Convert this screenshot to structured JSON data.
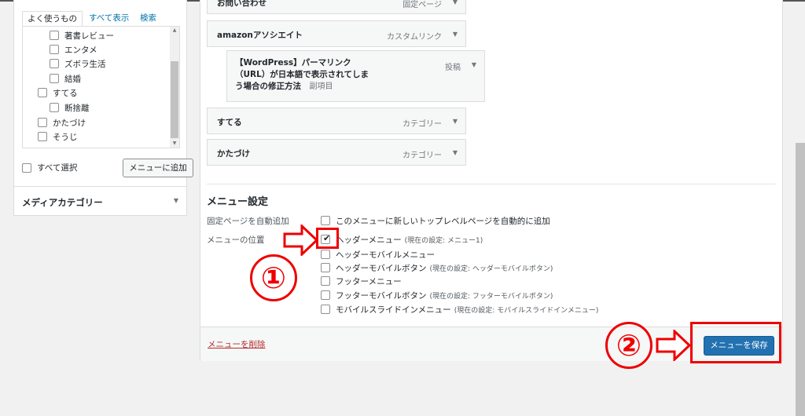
{
  "left_panel": {
    "tabs": [
      "よく使うもの",
      "すべて表示",
      "検索"
    ],
    "items": [
      {
        "label": "著書レビュー",
        "indent": 1
      },
      {
        "label": "エンタメ",
        "indent": 1
      },
      {
        "label": "ズボラ生活",
        "indent": 1
      },
      {
        "label": "結婚",
        "indent": 1
      },
      {
        "label": "すてる",
        "indent": 0
      },
      {
        "label": "断捨離",
        "indent": 1
      },
      {
        "label": "かたづけ",
        "indent": 0
      },
      {
        "label": "そうじ",
        "indent": 0
      }
    ],
    "select_all": "すべて選択",
    "add_button": "メニューに追加",
    "media_category": "メディアカテゴリー"
  },
  "menu_items": [
    {
      "title": "お問い合わせ",
      "type": "固定ページ"
    },
    {
      "title": "amazonアソシエイト",
      "type": "カスタムリンク"
    },
    {
      "title": "【WordPress】パーマリンク（URL）が日本語で表示されてしまう場合の修正方法",
      "title_lines": [
        "【WordPress】パーマリンク",
        "（URL）が日本語で表示されてしま",
        "う場合の修正方法"
      ],
      "sub_note": "副項目",
      "type": "投稿"
    },
    {
      "title": "すてる",
      "type": "カテゴリー"
    },
    {
      "title": "かたづけ",
      "type": "カテゴリー"
    }
  ],
  "settings": {
    "heading": "メニュー設定",
    "auto_add_label": "固定ページを自動追加",
    "auto_add_option": "このメニューに新しいトップレベルページを自動的に追加",
    "location_label": "メニューの位置",
    "locations": [
      {
        "label": "ヘッダーメニュー",
        "note": "(現在の設定: メニュー1)",
        "checked": true
      },
      {
        "label": "ヘッダーモバイルメニュー",
        "note": "",
        "checked": false
      },
      {
        "label": "ヘッダーモバイルボタン",
        "note": "(現在の設定: ヘッダーモバイルボタン)",
        "checked": false
      },
      {
        "label": "フッターメニュー",
        "note": "",
        "checked": false
      },
      {
        "label": "フッターモバイルボタン",
        "note": "(現在の設定: フッターモバイルボタン)",
        "checked": false
      },
      {
        "label": "モバイルスライドインメニュー",
        "note": "(現在の設定: モバイルスライドインメニュー)",
        "checked": false
      }
    ]
  },
  "footer": {
    "delete_link": "メニューを削除",
    "save_button": "メニューを保存"
  },
  "annotations": {
    "step1": "①",
    "step2": "②"
  },
  "colors": {
    "accent": "#2271b1",
    "link": "#0073aa",
    "delete": "#b32d2e",
    "annotation_red": "#e00000"
  }
}
